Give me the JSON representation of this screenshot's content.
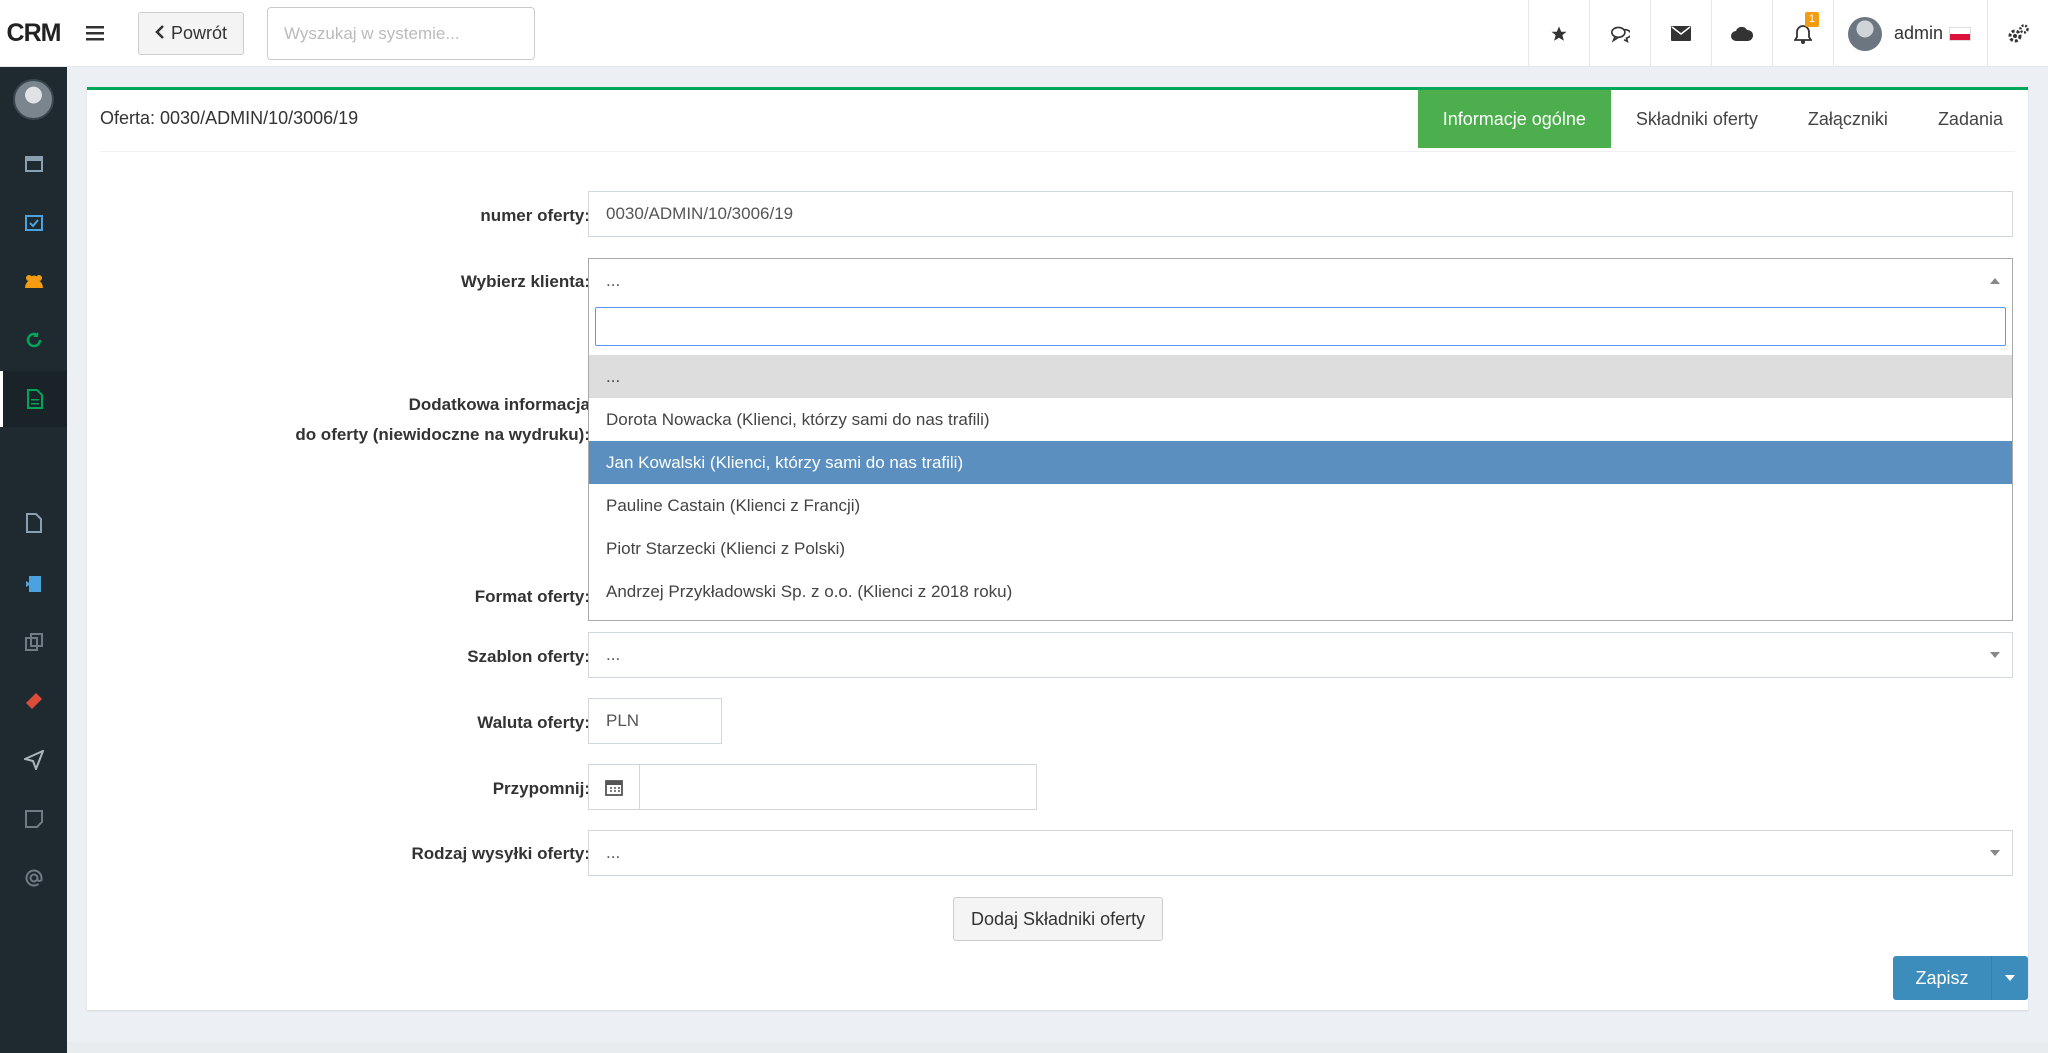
{
  "header": {
    "logo": "CRM",
    "back_label": "Powrót",
    "search_placeholder": "Wyszukaj w systemie...",
    "notification_count": "1",
    "user_name": "admin"
  },
  "panel": {
    "title": "Oferta: 0030/ADMIN/10/3006/19",
    "tabs": [
      "Informacje ogólne",
      "Składniki oferty",
      "Załączniki",
      "Zadania"
    ]
  },
  "form": {
    "offer_number_label": "numer oferty:",
    "offer_number_value": "0030/ADMIN/10/3006/19",
    "client_label": "Wybierz klienta:",
    "client_value": "...",
    "additional_info_label_1": "Dodatkowa informacja",
    "additional_info_label_2": "do oferty (niewidoczne na wydruku):",
    "format_label": "Format oferty:",
    "template_label": "Szablon oferty:",
    "template_value": "...",
    "currency_label": "Waluta oferty:",
    "currency_value": "PLN",
    "remind_label": "Przypomnij:",
    "remind_value": "",
    "shipping_label": "Rodzaj wysyłki oferty:",
    "shipping_value": "...",
    "add_components_button": "Dodaj Składniki oferty",
    "save_button": "Zapisz"
  },
  "dropdown": {
    "search_value": "",
    "options": [
      "...",
      "Dorota Nowacka (Klienci, którzy sami do nas trafili)",
      "Jan Kowalski (Klienci, którzy sami do nas trafili)",
      "Pauline Castain (Klienci z Francji)",
      "Piotr Starzecki (Klienci z Polski)",
      "Andrzej Przykładowski Sp. z o.o. (Klienci z 2018 roku)"
    ],
    "highlighted_index": 2
  },
  "colors": {
    "accent_green": "#4cae4c",
    "primary_blue": "#3c8dbc",
    "sidebar_bg": "#1f2a30",
    "highlight": "#5b8fbf"
  },
  "sidebar_icons": [
    "calendar-icon",
    "calendar-check-icon",
    "users-icon",
    "refresh-icon",
    "document-icon",
    "pdf-icon",
    "clipboard-icon",
    "copy-icon",
    "ticket-icon",
    "send-icon",
    "note-icon",
    "at-icon"
  ]
}
